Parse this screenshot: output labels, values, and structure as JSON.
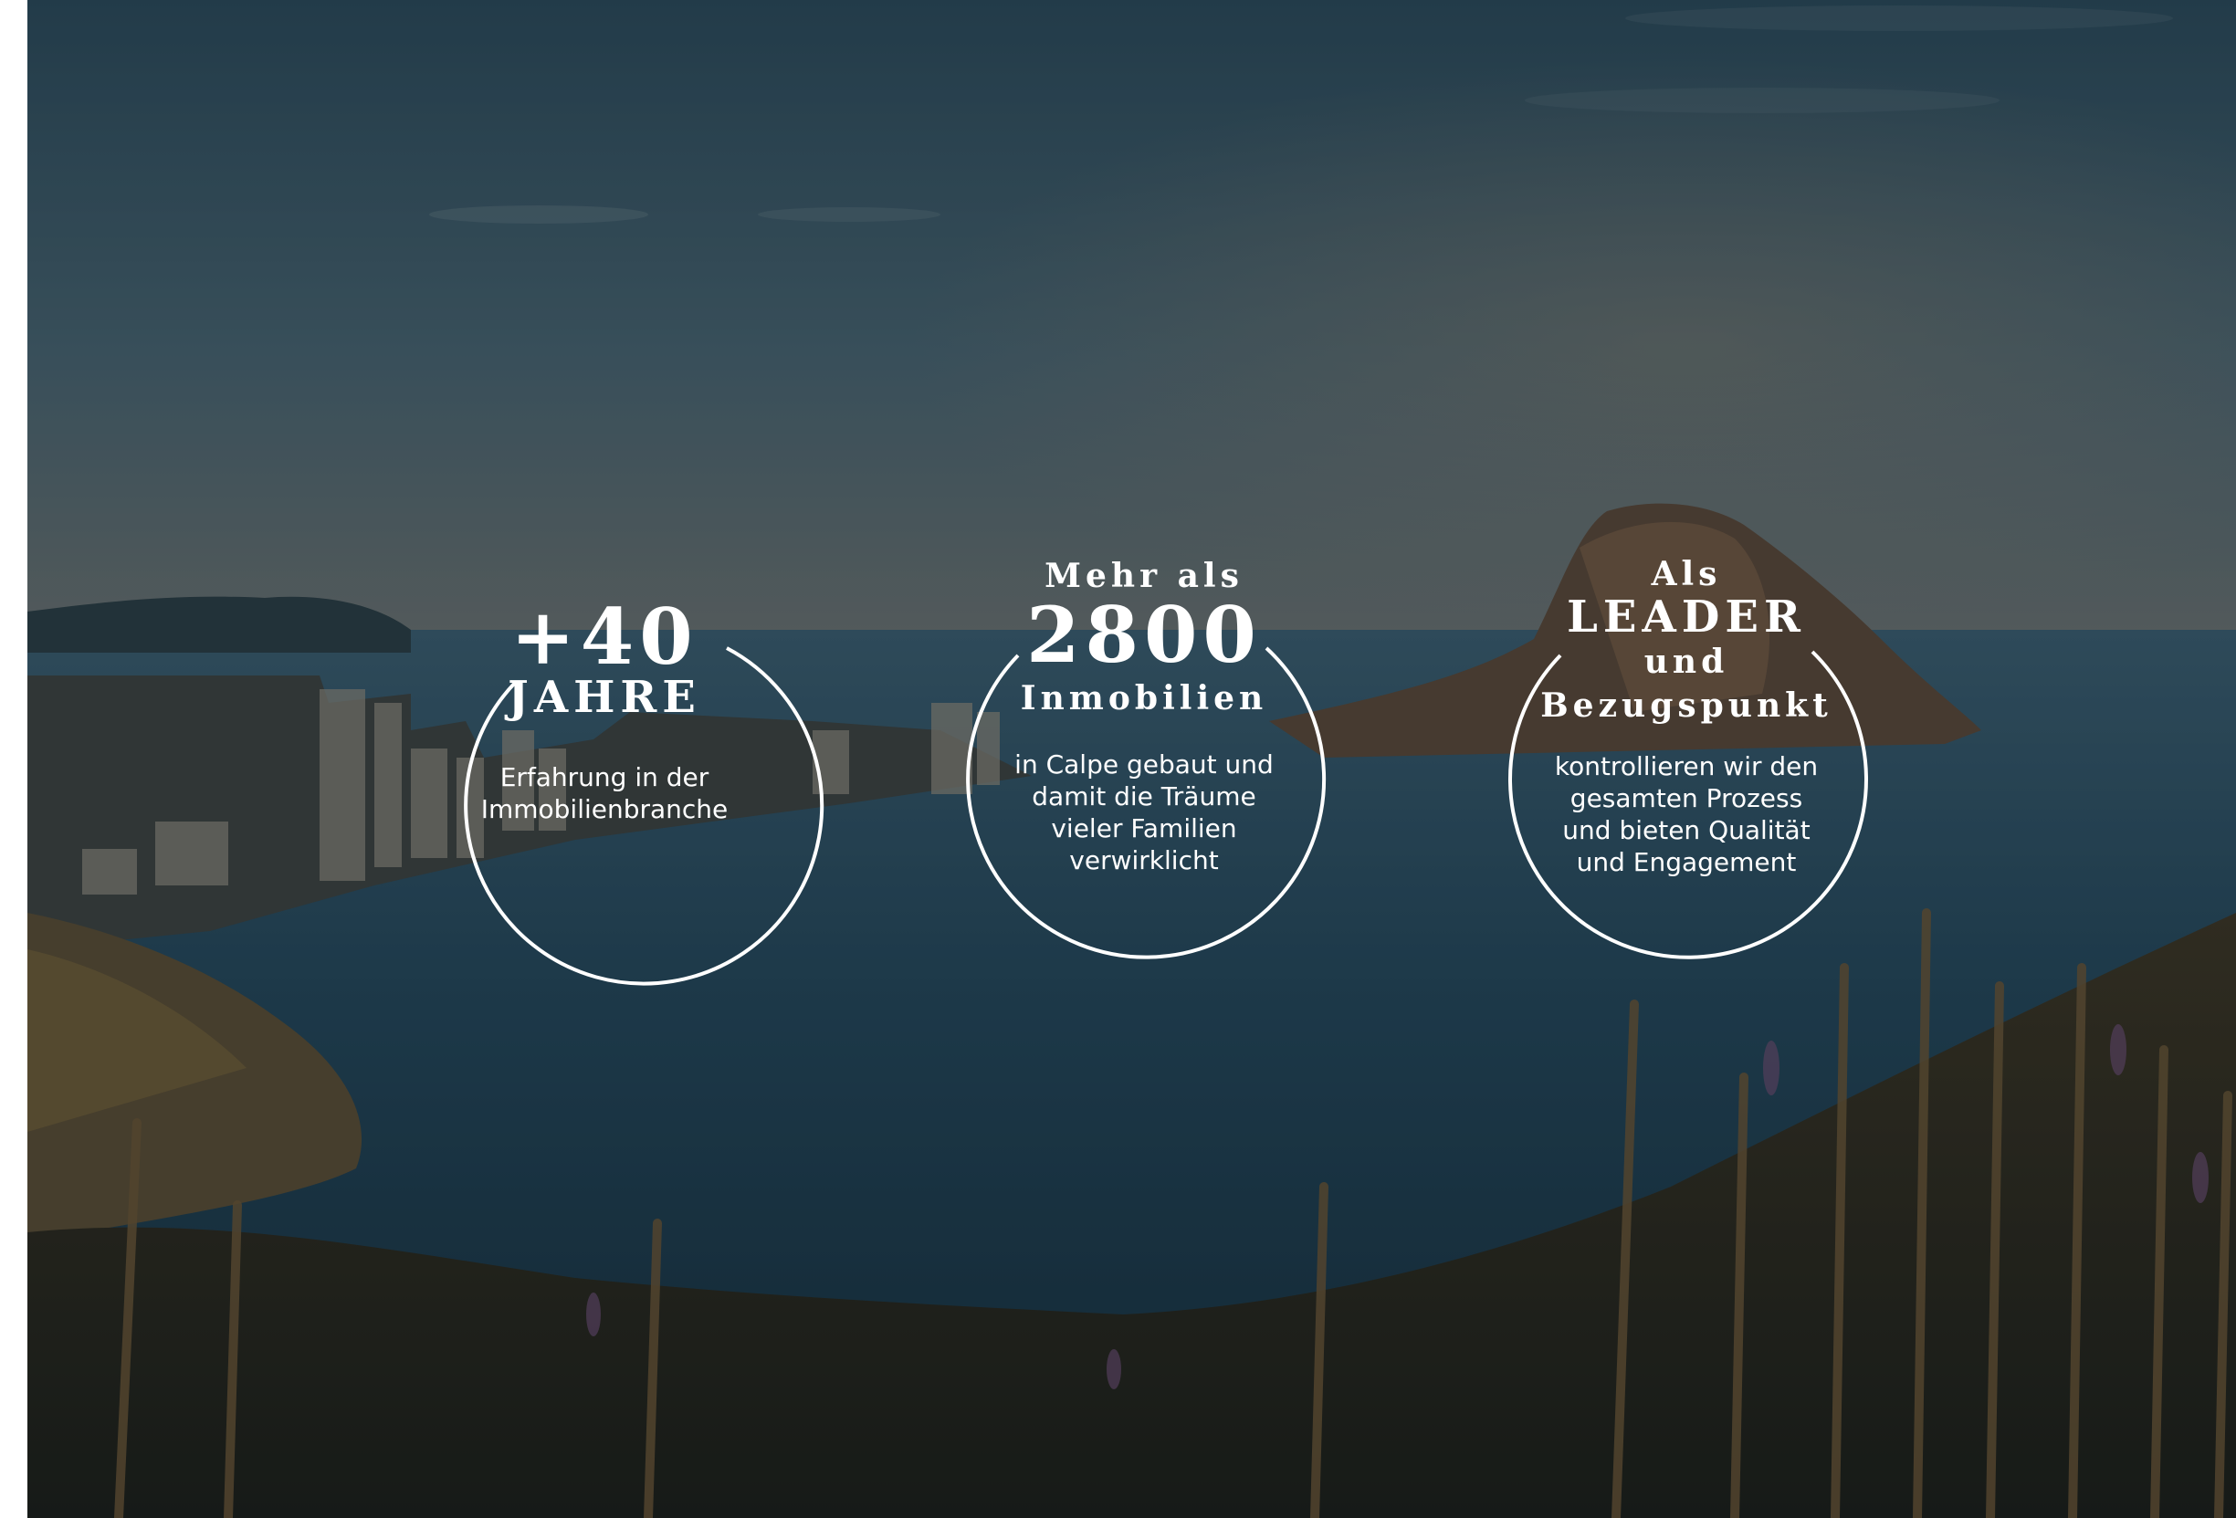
{
  "stats": [
    {
      "top": "",
      "big": "+40",
      "mid": "JAHRE",
      "desc": [
        "Erfahrung in der",
        "Immobilienbranche"
      ]
    },
    {
      "top": "Mehr als",
      "big": "2800",
      "mid": "Inmobilien",
      "desc": [
        "in Calpe gebaut und",
        "damit die Träume",
        "vieler Familien",
        "verwirklicht"
      ]
    },
    {
      "top": "Als",
      "big": "LEADER",
      "mid": "und",
      "mid2": "Bezugspunkt",
      "desc": [
        "kontrollieren wir den",
        "gesamten Prozess",
        "und bieten Qualität",
        "und Engagement"
      ]
    }
  ],
  "colors": {
    "text": "#ffffff",
    "sky_top": "#2c4a5a",
    "sea": "#1f3a4c",
    "overlay": "#0b1a24"
  }
}
